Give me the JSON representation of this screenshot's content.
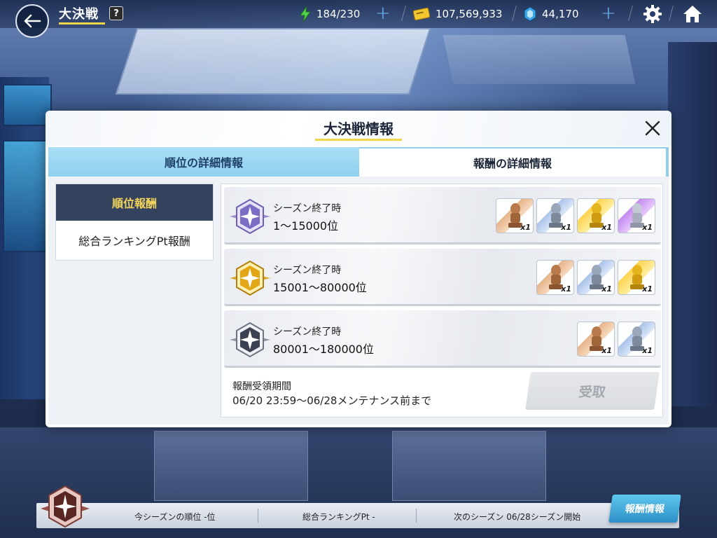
{
  "header": {
    "title": "大決戦",
    "help": "?",
    "stamina": "184/230",
    "coins": "107,569,933",
    "crystals": "44,170"
  },
  "modal": {
    "title": "大決戦情報",
    "tabs": [
      {
        "label": "順位の詳細情報"
      },
      {
        "label": "報酬の詳細情報"
      }
    ],
    "side_menu": [
      {
        "label": "順位報酬"
      },
      {
        "label": "総合ランキングPt報酬"
      }
    ],
    "rewards": [
      {
        "caption": "シーズン終了時",
        "range": "1〜15000位",
        "medal": "purple-medal-icon",
        "items": [
          {
            "type": "bronze",
            "qty": "x1"
          },
          {
            "type": "silver",
            "qty": "x1"
          },
          {
            "type": "gold",
            "qty": "x1"
          },
          {
            "type": "purple",
            "qty": "x1"
          }
        ]
      },
      {
        "caption": "シーズン終了時",
        "range": "15001〜80000位",
        "medal": "gold-medal-icon",
        "items": [
          {
            "type": "bronze",
            "qty": "x1"
          },
          {
            "type": "silver",
            "qty": "x1"
          },
          {
            "type": "gold",
            "qty": "x1"
          }
        ]
      },
      {
        "caption": "シーズン終了時",
        "range": "80001〜180000位",
        "medal": "silver-medal-icon",
        "items": [
          {
            "type": "bronze",
            "qty": "x1"
          },
          {
            "type": "silver",
            "qty": "x1"
          }
        ]
      }
    ],
    "period_label": "報酬受領期間",
    "period_value": "06/20 23:59〜06/28メンテナンス前まで",
    "claim_label": "受取"
  },
  "bottom": {
    "rank": "今シーズンの順位 -位",
    "pt": "総合ランキングPt -",
    "next": "次のシーズン 06/28シーズン開始",
    "info_button": "報酬情報"
  }
}
